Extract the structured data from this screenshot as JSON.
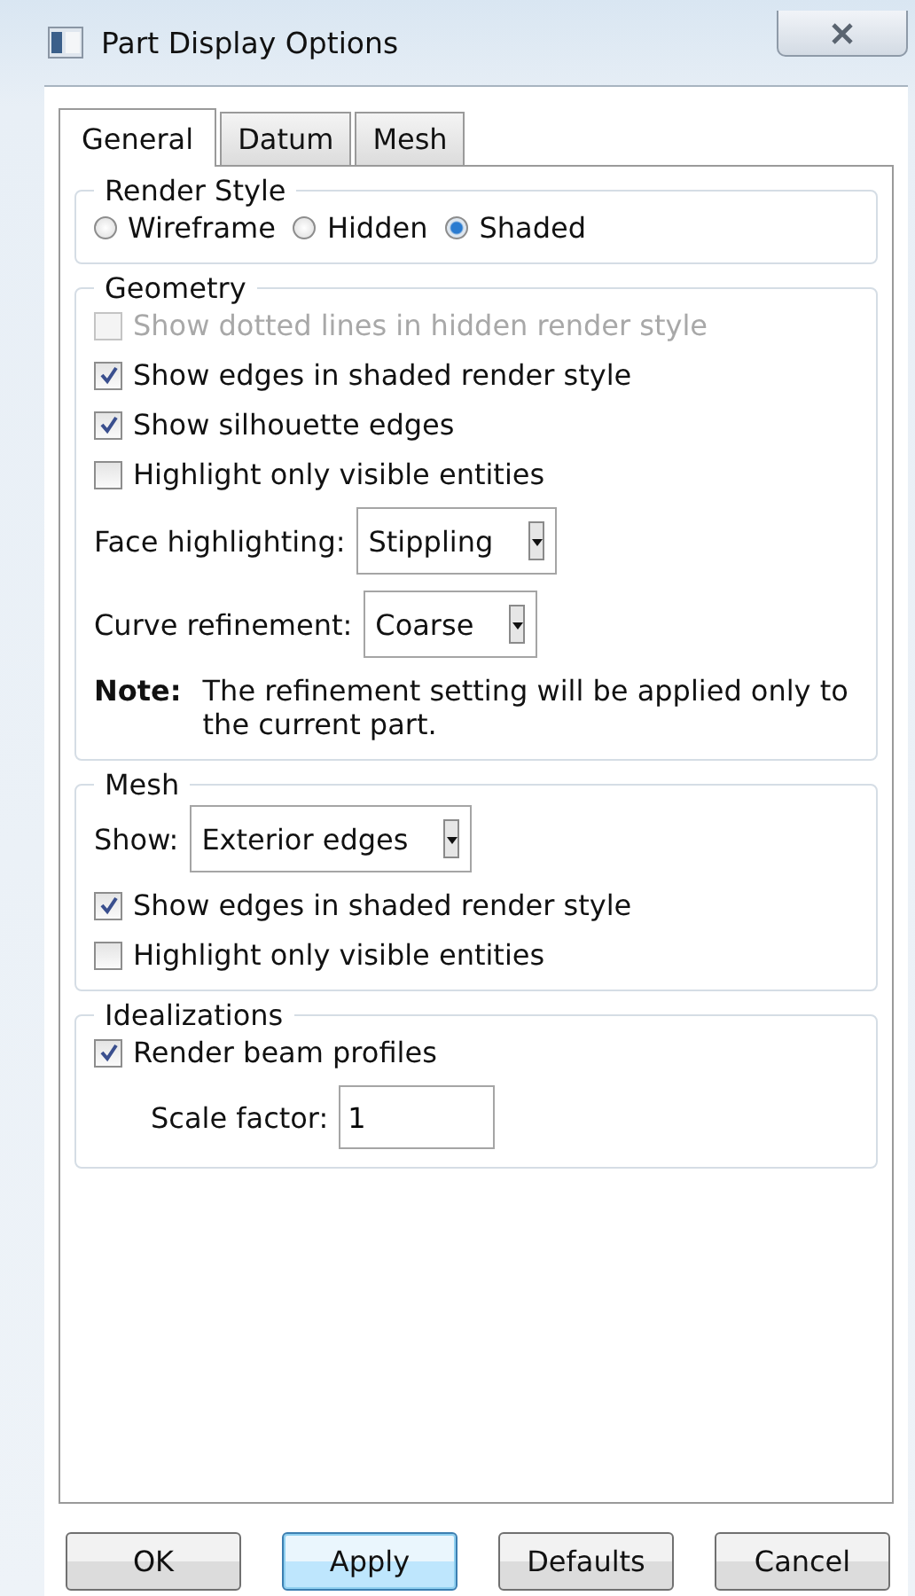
{
  "window": {
    "title": "Part Display Options"
  },
  "tabs": [
    {
      "label": "General",
      "selected": true
    },
    {
      "label": "Datum",
      "selected": false
    },
    {
      "label": "Mesh",
      "selected": false
    }
  ],
  "groups": [
    {
      "title": "Render Style",
      "items": [
        {
          "kind": "radios",
          "options": [
            {
              "label": "Wireframe",
              "selected": false
            },
            {
              "label": "Hidden",
              "selected": false
            },
            {
              "label": "Shaded",
              "selected": true
            }
          ]
        }
      ]
    },
    {
      "title": "Geometry",
      "items": [
        {
          "kind": "checkbox",
          "label": "Show dotted lines in hidden render style",
          "checked": false,
          "disabled": true
        },
        {
          "kind": "checkbox",
          "label": "Show edges in shaded render style",
          "checked": true,
          "disabled": false
        },
        {
          "kind": "checkbox",
          "label": "Show silhouette edges",
          "checked": true,
          "disabled": false
        },
        {
          "kind": "checkbox",
          "label": "Highlight only visible entities",
          "checked": false,
          "disabled": false
        },
        {
          "kind": "dropdown",
          "label": "Face highlighting:",
          "value": "Stippling"
        },
        {
          "kind": "dropdown",
          "label": "Curve refinement:",
          "value": "Coarse"
        },
        {
          "kind": "note",
          "label": "Note:",
          "text": "The refinement setting will be applied only to the current part."
        }
      ]
    },
    {
      "title": "Mesh",
      "items": [
        {
          "kind": "dropdown",
          "label": "Show:",
          "value": "Exterior edges"
        },
        {
          "kind": "checkbox",
          "label": "Show edges in shaded render style",
          "checked": true,
          "disabled": false
        },
        {
          "kind": "checkbox",
          "label": "Highlight only visible entities",
          "checked": false,
          "disabled": false
        }
      ]
    },
    {
      "title": "Idealizations",
      "items": [
        {
          "kind": "checkbox",
          "label": "Render beam profiles",
          "checked": true,
          "disabled": false
        },
        {
          "kind": "field",
          "label": "Scale factor:",
          "value": "1"
        }
      ]
    }
  ],
  "buttons": [
    {
      "label": "OK",
      "focused": false
    },
    {
      "label": "Apply",
      "focused": true
    },
    {
      "label": "Defaults",
      "focused": false
    },
    {
      "label": "Cancel",
      "focused": false
    }
  ]
}
